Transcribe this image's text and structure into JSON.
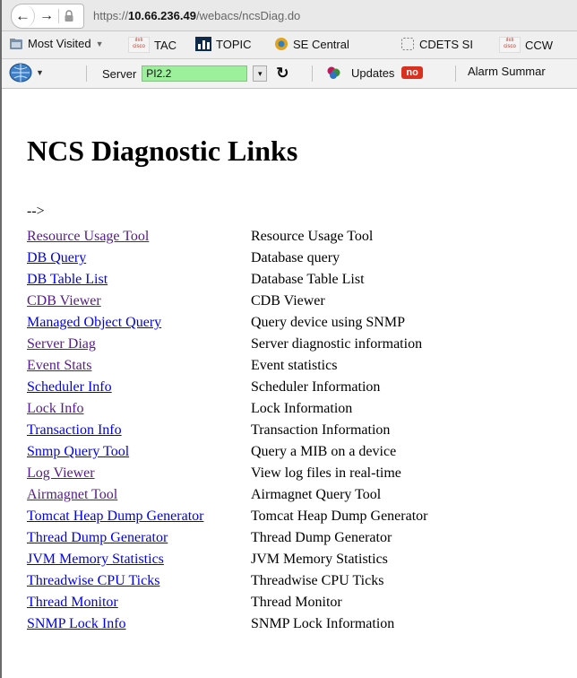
{
  "browser": {
    "url_prefix": "https://",
    "url_host": "10.66.236.49",
    "url_path": "/webacs/ncsDiag.do"
  },
  "bookmarks": [
    {
      "label": "Most Visited",
      "icon": "bookmarks-folder-icon",
      "has_dropdown": true
    },
    {
      "label": "TAC",
      "icon": "cisco-logo-icon"
    },
    {
      "label": "TOPIC",
      "icon": "topic-bars-icon"
    },
    {
      "label": "SE Central",
      "icon": "se-central-icon"
    },
    {
      "label": "CDETS SI",
      "icon": "dashed-page-icon"
    },
    {
      "label": "CCW",
      "icon": "cisco-logo-icon"
    }
  ],
  "toolbar": {
    "server_label": "Server",
    "server_value": "PI2.2",
    "updates_label": "Updates",
    "updates_badge": "no",
    "alarm_label": "Alarm Summar",
    "colors": {
      "server_field": "#9cf09c",
      "badge": "#d9301f"
    }
  },
  "page": {
    "title": "NCS Diagnostic Links",
    "comment_artifact": "-->",
    "links": [
      {
        "label": "Resource Usage Tool",
        "description": "Resource Usage Tool",
        "visited": true
      },
      {
        "label": "DB Query",
        "description": "Database query",
        "visited": false
      },
      {
        "label": "DB Table List",
        "description": "Database Table List",
        "visited": false
      },
      {
        "label": "CDB Viewer",
        "description": "CDB Viewer",
        "visited": true
      },
      {
        "label": "Managed Object Query",
        "description": "Query device using SNMP",
        "visited": false
      },
      {
        "label": "Server Diag",
        "description": "Server diagnostic information",
        "visited": true
      },
      {
        "label": "Event Stats",
        "description": "Event statistics",
        "visited": true
      },
      {
        "label": "Scheduler Info",
        "description": "Scheduler Information",
        "visited": false
      },
      {
        "label": "Lock Info",
        "description": "Lock Information",
        "visited": true
      },
      {
        "label": "Transaction Info",
        "description": "Transaction Information",
        "visited": false
      },
      {
        "label": "Snmp Query Tool",
        "description": "Query a MIB on a device",
        "visited": false
      },
      {
        "label": "Log Viewer",
        "description": "View log files in real-time",
        "visited": true
      },
      {
        "label": "Airmagnet Tool",
        "description": "Airmagnet Query Tool",
        "visited": true
      },
      {
        "label": "Tomcat Heap Dump Generator",
        "description": "Tomcat Heap Dump Generator",
        "visited": false
      },
      {
        "label": "Thread Dump Generator",
        "description": "Thread Dump Generator",
        "visited": false
      },
      {
        "label": "JVM Memory Statistics",
        "description": "JVM Memory Statistics",
        "visited": false
      },
      {
        "label": "Threadwise CPU Ticks",
        "description": "Threadwise CPU Ticks",
        "visited": false
      },
      {
        "label": "Thread Monitor",
        "description": "Thread Monitor",
        "visited": false
      },
      {
        "label": "SNMP Lock Info",
        "description": "SNMP Lock Information",
        "visited": false
      }
    ]
  }
}
